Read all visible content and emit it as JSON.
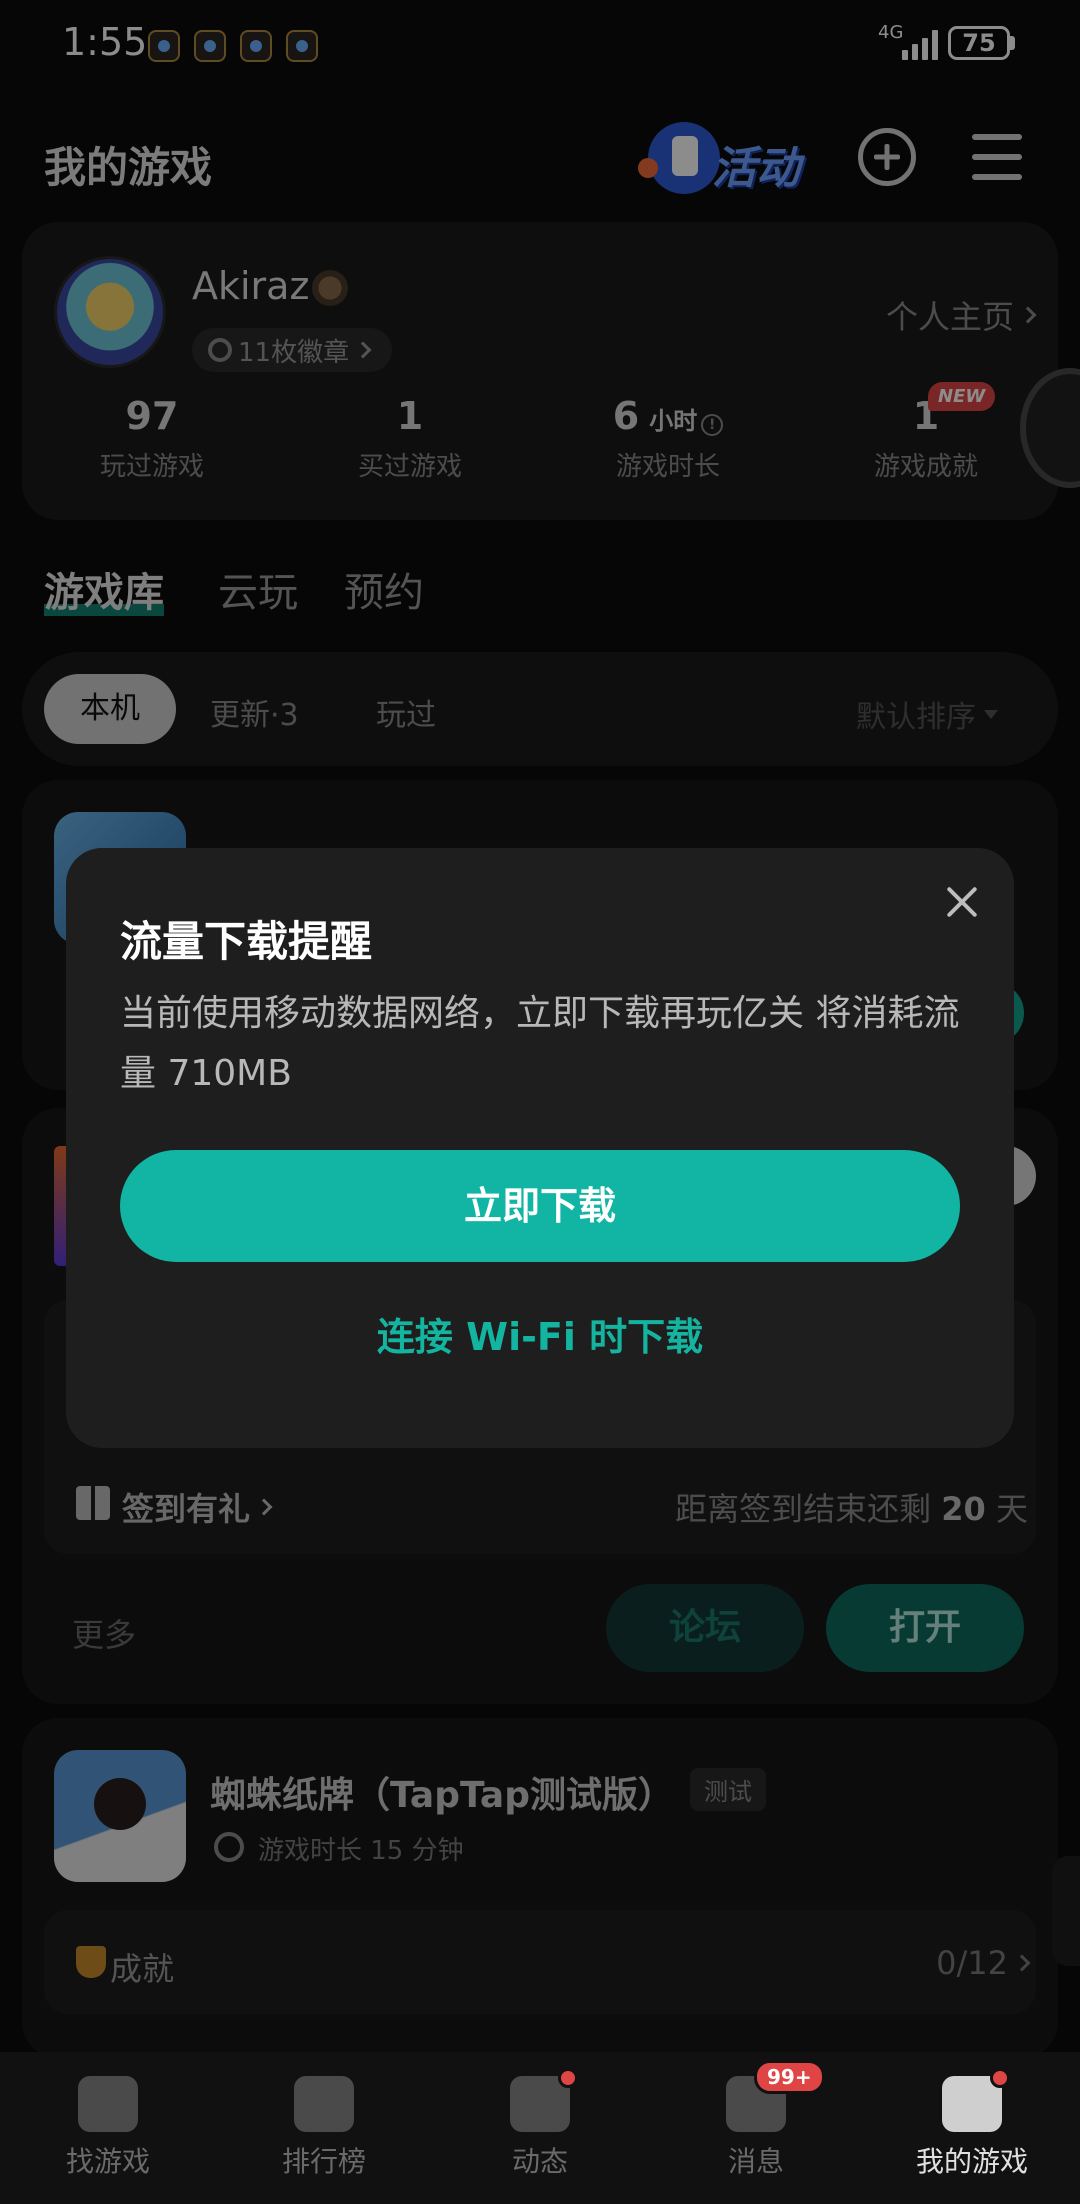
{
  "status_bar": {
    "time": "1:55",
    "network": "4G",
    "battery": "75"
  },
  "header": {
    "title": "我的游戏",
    "activity_label": "活动"
  },
  "profile": {
    "username": "Akiraz",
    "badges": "11枚徽章",
    "home_link": "个人主页",
    "stats": [
      {
        "value": "97",
        "label": "玩过游戏"
      },
      {
        "value": "1",
        "label": "买过游戏"
      },
      {
        "value": "6",
        "unit": "小时",
        "label": "游戏时长"
      },
      {
        "value": "1",
        "label": "游戏成就",
        "badge": "NEW"
      }
    ]
  },
  "tabs": [
    "游戏库",
    "云玩",
    "预约"
  ],
  "filters": {
    "chips": [
      "本机",
      "更新·3",
      "玩过"
    ],
    "sort": "默认排序"
  },
  "game2": {
    "checkin_label": "签到有礼",
    "checkin_remaining_prefix": "距离签到结束还剩",
    "checkin_days": "20",
    "checkin_remaining_suffix": "天",
    "more": "更多",
    "forum": "论坛",
    "open": "打开"
  },
  "game3": {
    "title": "蜘蛛纸牌（TapTap测试版）",
    "tag": "测试",
    "playtime": "游戏时长 15 分钟",
    "achievements_label": "成就",
    "achievements_count": "0/12"
  },
  "dialog": {
    "title": "流量下载提醒",
    "body": "当前使用移动数据网络，立即下载再玩亿关 将消耗流量 710MB",
    "primary": "立即下载",
    "secondary": "连接 Wi-Fi 时下载"
  },
  "bottom_nav": [
    {
      "label": "找游戏",
      "icon": "taptap-icon"
    },
    {
      "label": "排行榜",
      "icon": "ranking-icon"
    },
    {
      "label": "动态",
      "icon": "feed-icon"
    },
    {
      "label": "消息",
      "icon": "message-icon",
      "badge": "99+"
    },
    {
      "label": "我的游戏",
      "icon": "gamepad-icon"
    }
  ],
  "colors": {
    "accent": "#12b5a3",
    "background": "#0b0b0b",
    "card": "#1a1a1a",
    "badge_red": "#e04545"
  }
}
